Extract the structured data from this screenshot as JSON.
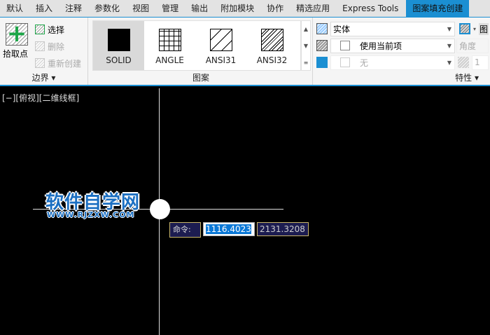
{
  "tabs": [
    "默认",
    "插入",
    "注释",
    "参数化",
    "视图",
    "管理",
    "输出",
    "附加模块",
    "协作",
    "精选应用",
    "Express Tools",
    "图案填充创建"
  ],
  "boundary": {
    "pick_points": "拾取点",
    "select": "选择",
    "remove": "删除",
    "recreate": "重新创建",
    "label": "边界"
  },
  "pattern": {
    "items": [
      "SOLID",
      "ANGLE",
      "ANSI31",
      "ANSI32"
    ],
    "selected": "SOLID",
    "label": "图案"
  },
  "properties": {
    "type": "实体",
    "color": "使用当前项",
    "background": "无",
    "angle": "角度",
    "scale": "1",
    "label": "特性",
    "overflow": "图"
  },
  "viewport": {
    "label": "[−][俯视][二维线框]",
    "watermark": "软件自学网",
    "watermark_url": "WWW.RJZXW.COM"
  },
  "command": {
    "prompt": "命令:",
    "x": "1116.4023",
    "y": "2131.3208"
  }
}
